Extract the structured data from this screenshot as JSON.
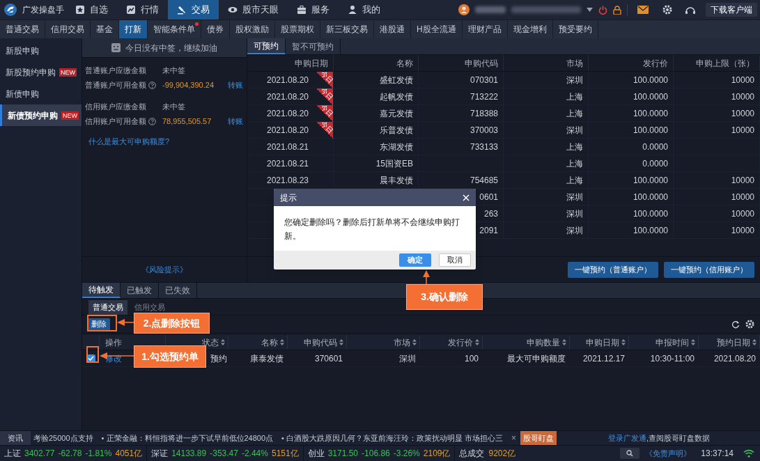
{
  "app": {
    "title": "广发操盘手"
  },
  "nav": [
    {
      "label": "自选",
      "selected": false
    },
    {
      "label": "行情",
      "selected": false
    },
    {
      "label": "交易",
      "selected": true
    },
    {
      "label": "股市天眼",
      "selected": false
    },
    {
      "label": "服务",
      "selected": false
    },
    {
      "label": "我的",
      "selected": false
    }
  ],
  "download_button": "下载客户端",
  "subtabs": [
    {
      "label": "普通交易",
      "selected": false,
      "dot": false
    },
    {
      "label": "信用交易",
      "selected": false,
      "dot": false
    },
    {
      "label": "基金",
      "selected": false,
      "dot": false
    },
    {
      "label": "打新",
      "selected": true,
      "dot": false
    },
    {
      "label": "智能条件单",
      "selected": false,
      "dot": true
    },
    {
      "label": "债券",
      "selected": false,
      "dot": false
    },
    {
      "label": "股权激励",
      "selected": false,
      "dot": false
    },
    {
      "label": "股票期权",
      "selected": false,
      "dot": false
    },
    {
      "label": "新三板交易",
      "selected": false,
      "dot": false
    },
    {
      "label": "港股通",
      "selected": false,
      "dot": false
    },
    {
      "label": "H股全流通",
      "selected": false,
      "dot": false
    },
    {
      "label": "理财产品",
      "selected": false,
      "dot": false
    },
    {
      "label": "现金增利",
      "selected": false,
      "dot": false
    },
    {
      "label": "预受要约",
      "selected": false,
      "dot": false
    }
  ],
  "sidebar": [
    {
      "label": "新股申购",
      "selected": false
    },
    {
      "label": "新股预约申购",
      "badge": "NEW",
      "selected": false
    },
    {
      "label": "新债申购",
      "selected": false
    },
    {
      "label": "新债预约申购",
      "badge": "NEW",
      "selected": true
    }
  ],
  "notice": "今日没有中签，继续加油",
  "accounts": [
    {
      "kind": "status",
      "label": "普通账户应缴金额",
      "value": "未中签"
    },
    {
      "kind": "amount",
      "label": "普通账户可用金额",
      "value": "-99,904,390.24",
      "link": "转账"
    },
    {
      "kind": "status",
      "label": "信用账户应缴金额",
      "value": "未中签"
    },
    {
      "kind": "amount",
      "label": "信用账户可用金额",
      "value": "78,955,505.57",
      "link": "转账"
    }
  ],
  "help_link": "什么是最大可申购额度?",
  "risk_link": "《风险提示》",
  "table": {
    "tabs": [
      {
        "label": "可预约",
        "selected": true
      },
      {
        "label": "暂不可预约",
        "selected": false
      }
    ],
    "columns": [
      "申购日期",
      "名称",
      "申购代码",
      "市场",
      "发行价",
      "申购上限（张）"
    ],
    "rows": [
      {
        "date": "2021.08.20",
        "tag": "今日",
        "name": "盛虹发债",
        "code": "070301",
        "market": "深圳",
        "price": "100.0000",
        "limit": "10000"
      },
      {
        "date": "2021.08.20",
        "tag": "今日",
        "name": "起帆发债",
        "code": "713222",
        "market": "上海",
        "price": "100.0000",
        "limit": "10000"
      },
      {
        "date": "2021.08.20",
        "tag": "今日",
        "name": "嘉元发债",
        "code": "718388",
        "market": "上海",
        "price": "100.0000",
        "limit": "10000"
      },
      {
        "date": "2021.08.20",
        "tag": "今日",
        "name": "乐普发债",
        "code": "370003",
        "market": "深圳",
        "price": "100.0000",
        "limit": "10000"
      },
      {
        "date": "2021.08.21",
        "name": "东湖发债",
        "code": "733133",
        "market": "上海",
        "price": "0.0000"
      },
      {
        "date": "2021.08.21",
        "name": "15国资EB",
        "market": "上海",
        "price": "0.0000"
      },
      {
        "date": "2021.08.23",
        "name": "晨丰发债",
        "code": "754685",
        "market": "上海",
        "price": "100.0000",
        "limit": "10000"
      },
      {
        "code": "0601",
        "market": "深圳",
        "price": "100.0000",
        "limit": "10000"
      },
      {
        "code": "263",
        "market": "深圳",
        "price": "100.0000",
        "limit": "10000"
      },
      {
        "code": "2091",
        "market": "深圳",
        "price": "100.0000",
        "limit": "10000"
      }
    ],
    "buttons": [
      "一键预约（普通账户）",
      "一键预约（信用账户）"
    ]
  },
  "dialog": {
    "title": "提示",
    "message": "您确定删除吗？删除后打新单将不会继续申购打新。",
    "buttons": [
      {
        "label": "确定",
        "primary": true
      },
      {
        "label": "取消",
        "primary": false
      }
    ]
  },
  "orders": {
    "tabs": [
      {
        "label": "待触发",
        "selected": true
      },
      {
        "label": "已触发",
        "selected": false
      },
      {
        "label": "已失效",
        "selected": false
      }
    ],
    "account_tabs": [
      {
        "label": "普通交易",
        "selected": true
      },
      {
        "label": "信用交易",
        "selected": false
      }
    ],
    "delete_button": "删除",
    "columns": [
      {
        "label": "操作",
        "sortable": false
      },
      {
        "label": "状态",
        "sortable": true
      },
      {
        "label": "名称",
        "sortable": true
      },
      {
        "label": "申购代码",
        "sortable": true
      },
      {
        "label": "市场",
        "sortable": true
      },
      {
        "label": "发行价",
        "sortable": true
      },
      {
        "label": "申购数量",
        "sortable": true
      },
      {
        "label": "申购日期",
        "sortable": true
      },
      {
        "label": "申报时间",
        "sortable": true
      },
      {
        "label": "预约日期",
        "sortable": true
      }
    ],
    "rows": [
      {
        "checked": true,
        "cells": [
          "修改",
          "预约",
          "康泰发债",
          "370601",
          "深圳",
          "100",
          "最大可申购额度",
          "2021.12.17",
          "10:30-11:00",
          "2021.08.20"
        ]
      }
    ]
  },
  "annotations": [
    "1.勾选预约单",
    "2.点删除按钮",
    "3.确认删除"
  ],
  "news": {
    "label": "资讯",
    "items": [
      "考验25000点支持",
      "• 正荣金融：料恒指将进一步下试早前低位24800点",
      "• 白酒股大跌原因几何？东亚前海汪玲：政策扰动明显 市场担心三"
    ],
    "close": "×",
    "badge": "股哥盯盘",
    "login_link": "登录广发通",
    "login_text": ",查阅股哥盯盘数据"
  },
  "status_bar": {
    "indices": [
      {
        "name": "上证",
        "price": "3402.77",
        "change": "-62.78",
        "pct": "-1.81%",
        "volume": "4051亿"
      },
      {
        "name": "深证",
        "price": "14133.89",
        "change": "-353.47",
        "pct": "-2.44%",
        "volume": "5151亿"
      },
      {
        "name": "创业",
        "price": "3171.50",
        "change": "-106.86",
        "pct": "-3.26%",
        "volume": "2109亿"
      }
    ],
    "total_label": "总成交",
    "total": "9202亿",
    "disclaimer": "《免责声明》",
    "time": "13:37:14"
  }
}
